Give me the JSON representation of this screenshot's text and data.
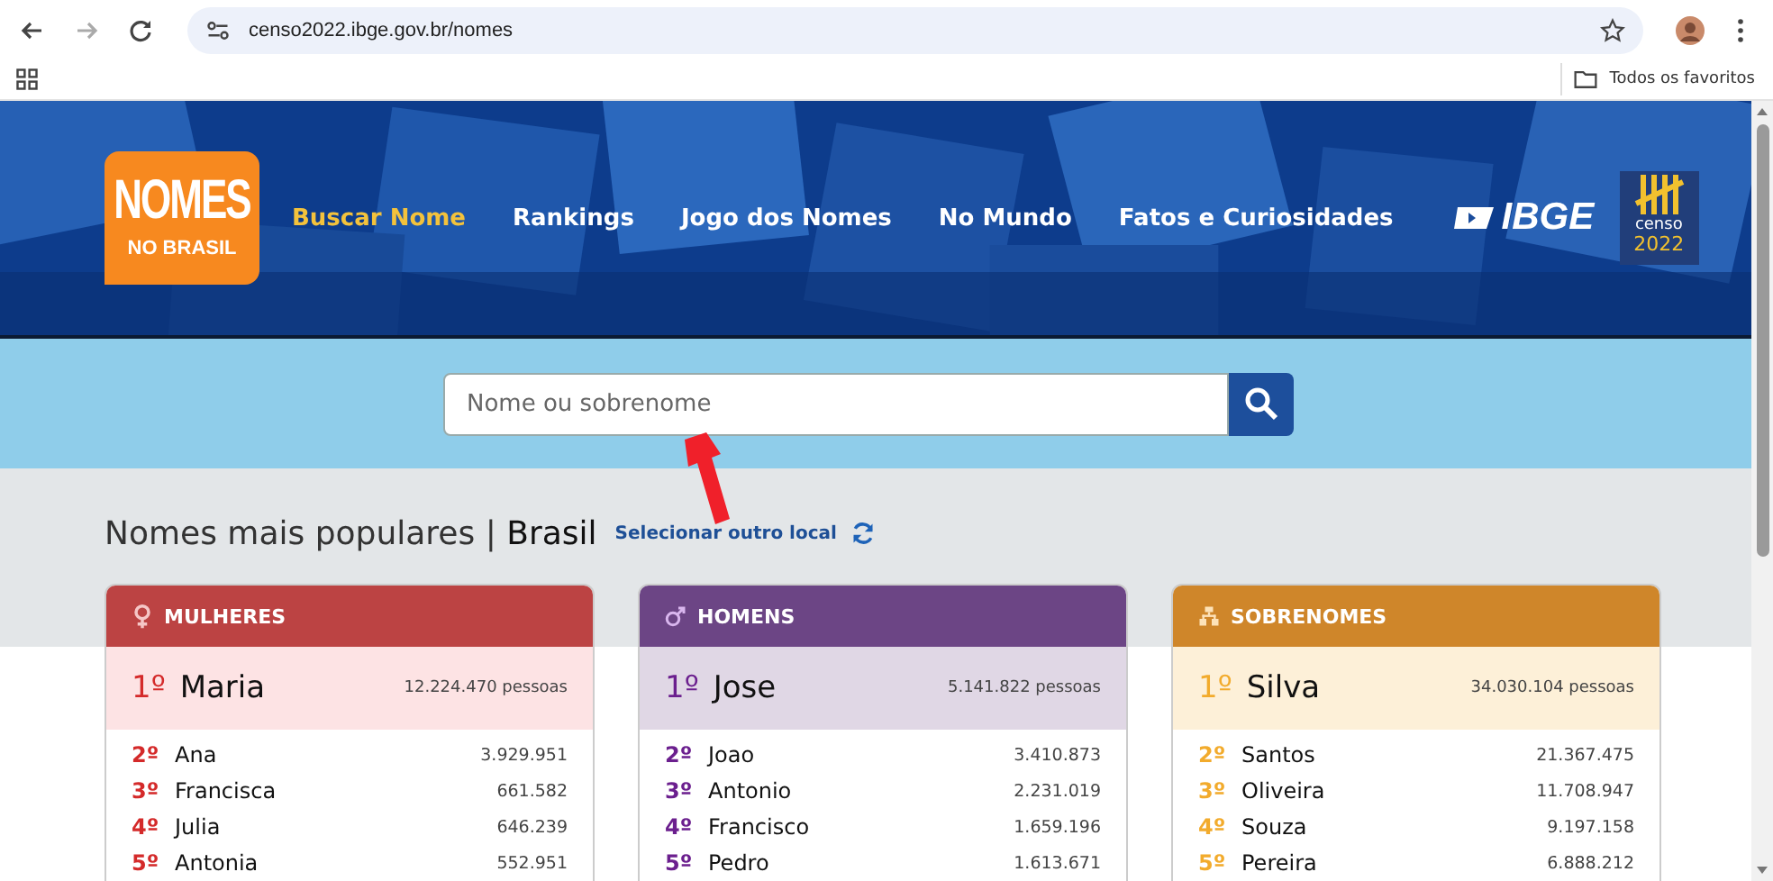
{
  "browser": {
    "url": "censo2022.ibge.gov.br/nomes",
    "bookmarks_folder": "Todos os favoritos"
  },
  "logo": {
    "title": "NOMES",
    "subtitle": "NO BRASIL"
  },
  "nav": [
    {
      "label": "Buscar Nome",
      "selected": true
    },
    {
      "label": "Rankings",
      "selected": false
    },
    {
      "label": "Jogo dos Nomes",
      "selected": false
    },
    {
      "label": "No Mundo",
      "selected": false
    },
    {
      "label": "Fatos e Curiosidades",
      "selected": false
    }
  ],
  "partner_logos": {
    "ibge": "IBGE",
    "censo": "censo",
    "year": "2022"
  },
  "search": {
    "placeholder": "Nome ou sobrenome"
  },
  "section": {
    "title": "Nomes mais populares | ",
    "place": "Brasil",
    "change_link": "Selecionar outro local"
  },
  "ranking_cards": [
    {
      "kind": "women",
      "title": "MULHERES",
      "color": "#bc4343",
      "top": {
        "rank": "1º",
        "name": "Maria",
        "count": "12.224.470 pessoas"
      },
      "rows": [
        {
          "rank": "2º",
          "name": "Ana",
          "count": "3.929.951"
        },
        {
          "rank": "3º",
          "name": "Francisca",
          "count": "661.582"
        },
        {
          "rank": "4º",
          "name": "Julia",
          "count": "646.239"
        },
        {
          "rank": "5º",
          "name": "Antonia",
          "count": "552.951"
        }
      ]
    },
    {
      "kind": "men",
      "title": "HOMENS",
      "color": "#6c4585",
      "top": {
        "rank": "1º",
        "name": "Jose",
        "count": "5.141.822 pessoas"
      },
      "rows": [
        {
          "rank": "2º",
          "name": "Joao",
          "count": "3.410.873"
        },
        {
          "rank": "3º",
          "name": "Antonio",
          "count": "2.231.019"
        },
        {
          "rank": "4º",
          "name": "Francisco",
          "count": "1.659.196"
        },
        {
          "rank": "5º",
          "name": "Pedro",
          "count": "1.613.671"
        }
      ]
    },
    {
      "kind": "surnames",
      "title": "SOBRENOMES",
      "color": "#cf862a",
      "top": {
        "rank": "1º",
        "name": "Silva",
        "count": "34.030.104 pessoas"
      },
      "rows": [
        {
          "rank": "2º",
          "name": "Santos",
          "count": "21.367.475"
        },
        {
          "rank": "3º",
          "name": "Oliveira",
          "count": "11.708.947"
        },
        {
          "rank": "4º",
          "name": "Souza",
          "count": "9.197.158"
        },
        {
          "rank": "5º",
          "name": "Pereira",
          "count": "6.888.212"
        }
      ]
    }
  ]
}
